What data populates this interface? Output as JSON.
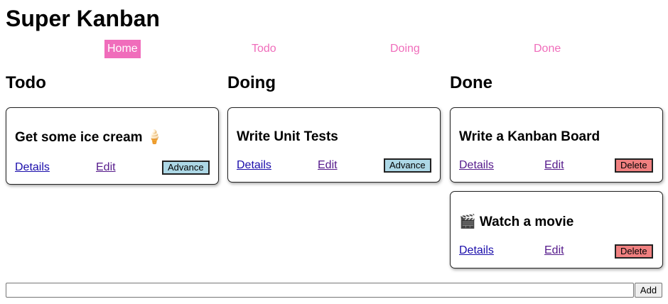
{
  "app": {
    "title": "Super Kanban"
  },
  "nav": {
    "items": [
      {
        "label": "Home"
      },
      {
        "label": "Todo"
      },
      {
        "label": "Doing"
      },
      {
        "label": "Done"
      }
    ],
    "active_color": "#f06dbb"
  },
  "columns": [
    {
      "title": "Todo",
      "cards": [
        {
          "title": "Get some ice cream 🍦",
          "details": "Details",
          "edit": "Edit",
          "action": "Advance"
        }
      ]
    },
    {
      "title": "Doing",
      "cards": [
        {
          "title": "Write Unit Tests",
          "details": "Details",
          "edit": "Edit",
          "action": "Advance"
        }
      ]
    },
    {
      "title": "Done",
      "cards": [
        {
          "title": "Write a Kanban Board",
          "details": "Details",
          "edit": "Edit",
          "action": "Delete"
        },
        {
          "title": "🎬 Watch a movie",
          "details": "Details",
          "edit": "Edit",
          "action": "Delete"
        }
      ]
    }
  ],
  "add_form": {
    "input_value": "",
    "button_label": "Add"
  },
  "colors": {
    "advance": "#add8e6",
    "delete": "#f08080",
    "nav_pink": "#f06dbb"
  }
}
